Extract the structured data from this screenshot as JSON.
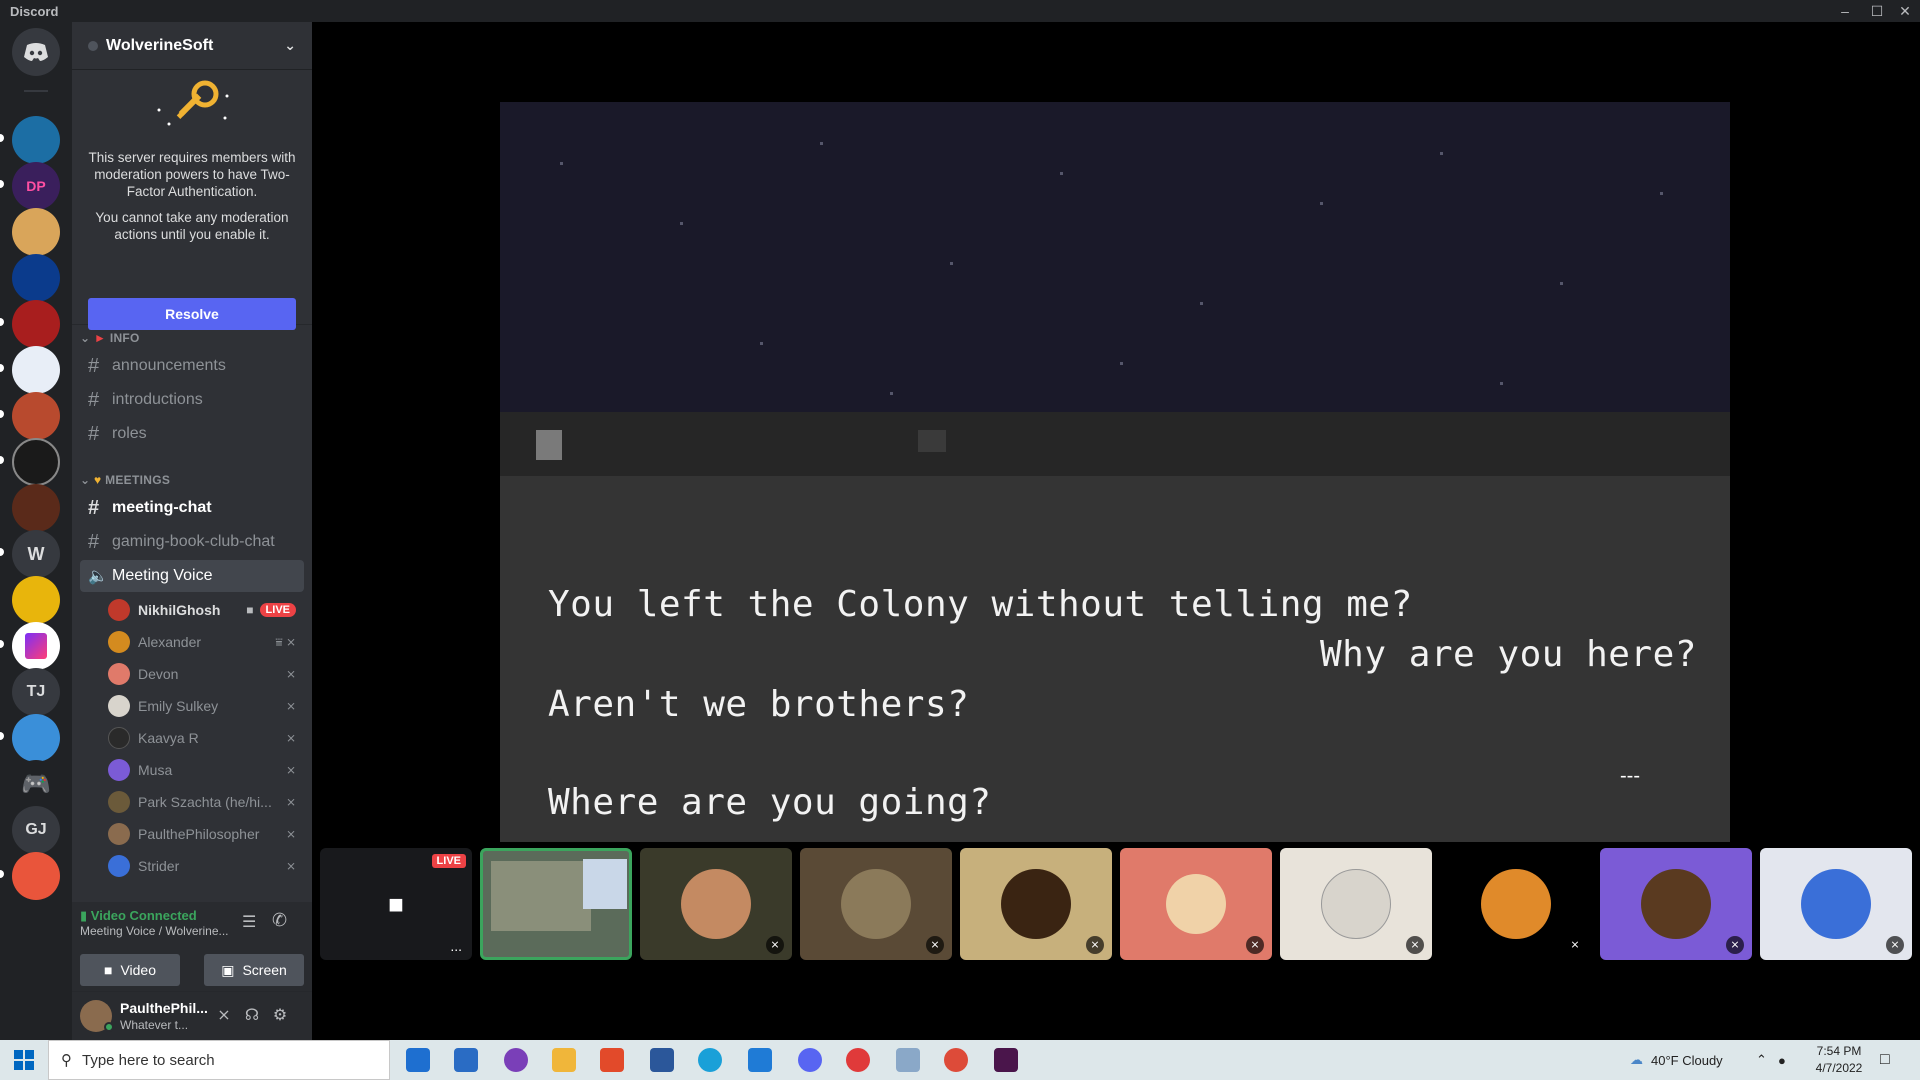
{
  "window": {
    "title": "Discord"
  },
  "server": {
    "name": "WolverineSoft",
    "notice_text": "This server requires members with moderation powers to have Two-Factor Authentication.",
    "notice_text2": "You cannot take any moderation actions until you enable it.",
    "resolve_label": "Resolve"
  },
  "rail": {
    "letters": {
      "w": "W",
      "tj": "TJ",
      "gj": "GJ"
    }
  },
  "categories": {
    "info": "INFO",
    "meetings": "MEETINGS"
  },
  "channels": {
    "announcements": "announcements",
    "introductions": "introductions",
    "roles": "roles",
    "meeting_chat": "meeting-chat",
    "gaming_book_club": "gaming-book-club-chat",
    "meeting_voice": "Meeting Voice"
  },
  "voice_users": [
    {
      "name": "NikhilGhosh",
      "live": "LIVE",
      "color": "#c0392b"
    },
    {
      "name": "Alexander",
      "color": "#d48b1f"
    },
    {
      "name": "Devon",
      "color": "#e07a6a"
    },
    {
      "name": "Emily Sulkey",
      "color": "#d8d4cc"
    },
    {
      "name": "Kaavya R",
      "color": "#2a2a2a"
    },
    {
      "name": "Musa",
      "color": "#7b5bd6"
    },
    {
      "name": "Park Szachta (he/hi...",
      "color": "#6b5a3a"
    },
    {
      "name": "PaulthePhilosopher",
      "color": "#8a6b4e"
    },
    {
      "name": "Strider",
      "color": "#3a6fd8"
    }
  ],
  "voice_panel": {
    "status": "Video Connected",
    "subtitle": "Meeting Voice / Wolverine...",
    "video_label": "Video",
    "screen_label": "Screen"
  },
  "user_panel": {
    "name": "PaulthePhil...",
    "status": "Whatever t..."
  },
  "stream": {
    "lines": [
      "You left the Colony without telling me?",
      "Why are you here?",
      "Aren't we brothers?",
      "Where are you going?"
    ],
    "ellipsis": "---"
  },
  "tiles": {
    "live_badge": "LIVE",
    "more_label": "..."
  },
  "taskbar": {
    "search_placeholder": "Type here to search",
    "weather": "40°F  Cloudy",
    "time": "7:54 PM",
    "date": "4/7/2022"
  },
  "colors": {
    "accent": "#5865f2",
    "live": "#ed4245",
    "connected": "#3ba55d"
  }
}
